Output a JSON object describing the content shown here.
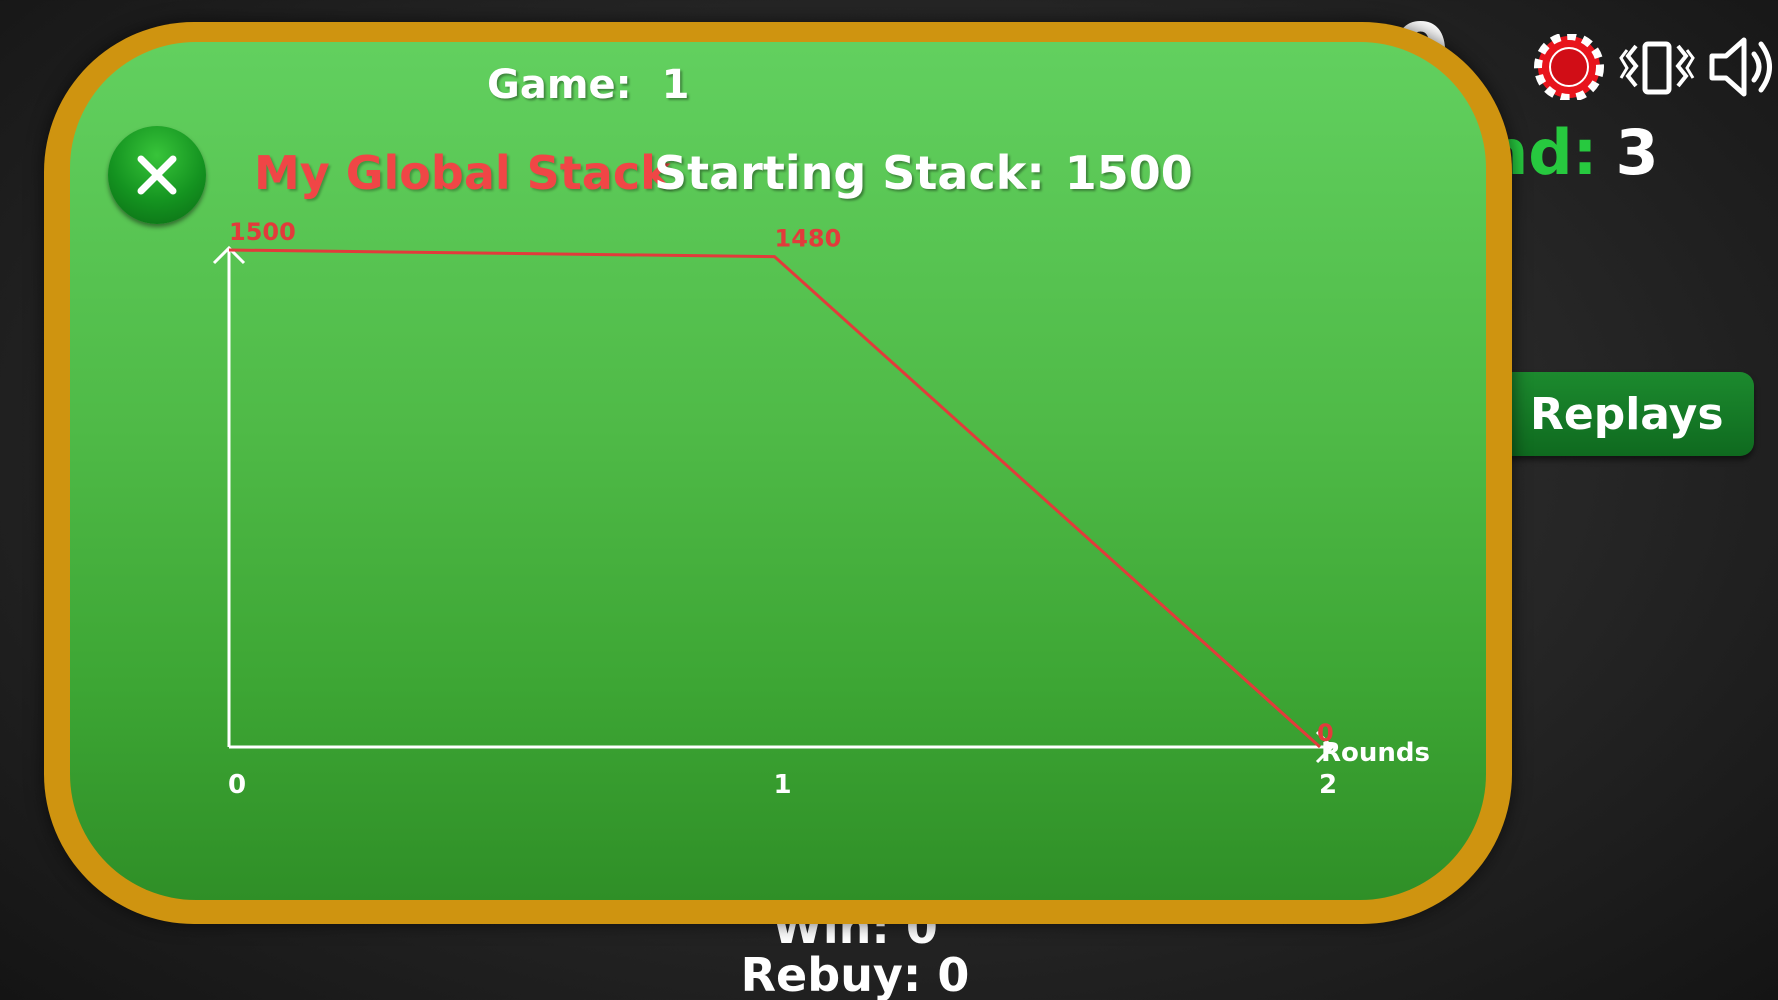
{
  "hud": {
    "score_fragment": "0",
    "round_label": "und:",
    "round_value": "3",
    "replays_label": "Replays",
    "win_text": "Win: 0",
    "rebuy_text": "Rebuy: 0"
  },
  "icons": {
    "chip": "poker-chip-icon",
    "vibrate": "vibrate-icon",
    "sound": "speaker-icon",
    "close": "close-icon"
  },
  "dialog": {
    "game_label": "Game:",
    "game_value": "1",
    "chart_title": "My Global Stack",
    "starting_stack_label": "Starting Stack:",
    "starting_stack_value": "1500"
  },
  "colors": {
    "border": "#cf9410",
    "panel_green": "#4fba47",
    "line_red": "#e23b3b",
    "title_red": "#f04646",
    "close_green": "#149320"
  },
  "chart_data": {
    "type": "line",
    "x": [
      0,
      1,
      2
    ],
    "values": [
      1500,
      1480,
      0
    ],
    "data_labels": [
      "1500",
      "1480",
      "0"
    ],
    "x_tick_labels": [
      "0",
      "1",
      "2"
    ],
    "xlabel": "Rounds",
    "ylabel": "",
    "title": "My Global Stack",
    "ylim": [
      0,
      1500
    ],
    "grid": false
  }
}
